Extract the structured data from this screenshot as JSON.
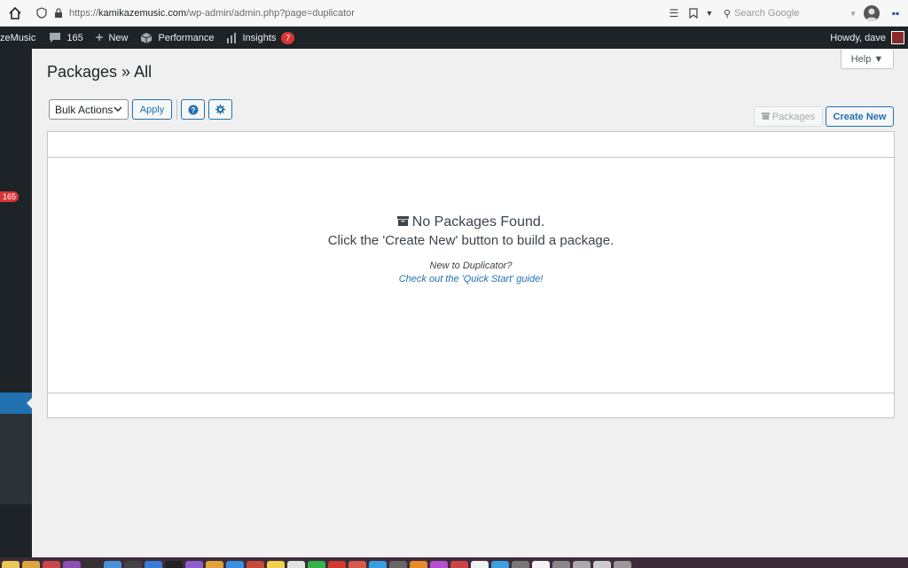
{
  "browser": {
    "url_prefix": "https://",
    "url_domain": "kamikazemusic.com",
    "url_path": "/wp-admin/admin.php?page=duplicator",
    "search_placeholder": "Search Google"
  },
  "adminbar": {
    "site_name": "zeMusic",
    "comments_count": "165",
    "new_label": "New",
    "performance_label": "Performance",
    "insights_label": "Insights",
    "insights_badge": "7",
    "howdy": "Howdy, dave"
  },
  "sidebar": {
    "badge": "165"
  },
  "help": {
    "label": "Help ▼"
  },
  "page": {
    "title": "Packages » All"
  },
  "toolbar": {
    "bulk_actions": "Bulk Actions",
    "apply_label": "Apply",
    "packages_label": "Packages",
    "create_new_label": "Create New"
  },
  "empty": {
    "title": "No Packages Found.",
    "subtitle": "Click the 'Create New' button to build a package.",
    "new_to": "New to Duplicator?",
    "quick_start": "Check out the 'Quick Start' guide!"
  },
  "colors": {
    "admin_bar": "#1d2327",
    "accent": "#2271b1",
    "badge": "#d63638"
  },
  "dock": {
    "icons": [
      "#e8c85a",
      "#d9a441",
      "#c9474c",
      "#8a4fb3",
      "#333333",
      "#4a90d9",
      "#444444",
      "#3a7bd5",
      "#222222",
      "#8e5bd1",
      "#e0a33a",
      "#3b8fe0",
      "#c84a3a",
      "#f2d14b",
      "#e2e2e2",
      "#34b34a",
      "#d13b2f",
      "#d65a4a",
      "#3a9ee0",
      "#666666",
      "#e8892a",
      "#b54fd1",
      "#cc4444",
      "#f0f0f0",
      "#3aa0e0",
      "#777777",
      "#f2f2f2",
      "#888888",
      "#aaaaaa",
      "#cccccc",
      "#999999"
    ]
  }
}
